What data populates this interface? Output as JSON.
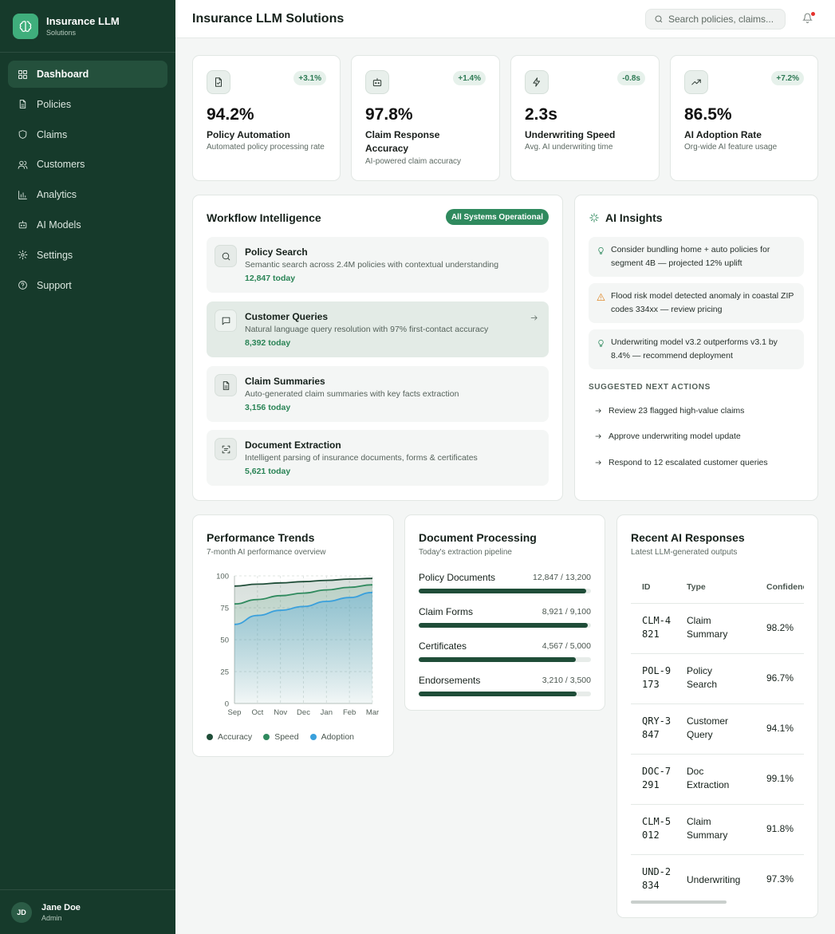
{
  "brand": {
    "title": "Insurance LLM",
    "subtitle": "Solutions"
  },
  "nav": [
    {
      "label": "Dashboard",
      "icon": "grid-icon",
      "active": true
    },
    {
      "label": "Policies",
      "icon": "document-icon"
    },
    {
      "label": "Claims",
      "icon": "shield-icon"
    },
    {
      "label": "Customers",
      "icon": "users-icon"
    },
    {
      "label": "Analytics",
      "icon": "bar-chart-icon"
    },
    {
      "label": "AI Models",
      "icon": "robot-icon"
    },
    {
      "label": "Settings",
      "icon": "gear-icon"
    },
    {
      "label": "Support",
      "icon": "help-circle-icon"
    }
  ],
  "user": {
    "initials": "JD",
    "name": "Jane Doe",
    "role": "Admin"
  },
  "header": {
    "title": "Insurance LLM Solutions",
    "search_placeholder": "Search policies, claims..."
  },
  "kpis": [
    {
      "value": "94.2%",
      "label": "Policy Automation",
      "desc": "Automated policy processing rate",
      "change": "+3.1%",
      "icon": "file-check-icon"
    },
    {
      "value": "97.8%",
      "label": "Claim Response Accuracy",
      "desc": "AI-powered claim accuracy",
      "change": "+1.4%",
      "icon": "robot-icon"
    },
    {
      "value": "2.3s",
      "label": "Underwriting Speed",
      "desc": "Avg. AI underwriting time",
      "change": "-0.8s",
      "icon": "lightning-icon"
    },
    {
      "value": "86.5%",
      "label": "AI Adoption Rate",
      "desc": "Org-wide AI feature usage",
      "change": "+7.2%",
      "icon": "trend-up-icon"
    }
  ],
  "workflow": {
    "title": "Workflow Intelligence",
    "status": "All Systems Operational",
    "items": [
      {
        "title": "Policy Search",
        "desc": "Semantic search across 2.4M policies with contextual understanding",
        "count": "12,847 today",
        "icon": "search-icon"
      },
      {
        "title": "Customer Queries",
        "desc": "Natural language query resolution with 97% first-contact accuracy",
        "count": "8,392 today",
        "icon": "message-icon"
      },
      {
        "title": "Claim Summaries",
        "desc": "Auto-generated claim summaries with key facts extraction",
        "count": "3,156 today",
        "icon": "document-icon"
      },
      {
        "title": "Document Extraction",
        "desc": "Intelligent parsing of insurance documents, forms & certificates",
        "count": "5,621 today",
        "icon": "scan-icon"
      }
    ]
  },
  "insights": {
    "title": "AI Insights",
    "items": [
      {
        "text": "Consider bundling home + auto policies for segment 4B — projected 12% uplift",
        "icon": "lightbulb-icon",
        "color": "#2f8a5e"
      },
      {
        "text": "Flood risk model detected anomaly in coastal ZIP codes 334xx — review pricing",
        "icon": "warning-icon",
        "color": "#e08a2c"
      },
      {
        "text": "Underwriting model v3.2 outperforms v3.1 by 8.4% — recommend deployment",
        "icon": "lightbulb-icon",
        "color": "#2f8a5e"
      }
    ],
    "next_heading": "SUGGESTED NEXT ACTIONS",
    "next_actions": [
      "Review 23 flagged high-value claims",
      "Approve underwriting model update",
      "Respond to 12 escalated customer queries"
    ]
  },
  "trends": {
    "title": "Performance Trends",
    "subtitle": "7-month AI performance overview"
  },
  "chart_data": {
    "type": "area",
    "categories": [
      "Sep",
      "Oct",
      "Nov",
      "Dec",
      "Jan",
      "Feb",
      "Mar"
    ],
    "ylim": [
      0,
      100
    ],
    "yticks": [
      0,
      25,
      50,
      75,
      100
    ],
    "grid": true,
    "legend": "bottom",
    "series": [
      {
        "name": "Accuracy",
        "color": "#1f4d38",
        "values": [
          92,
          93.5,
          94.5,
          95.5,
          96.5,
          97.5,
          98
        ]
      },
      {
        "name": "Speed",
        "color": "#2f8a5e",
        "values": [
          78,
          81.5,
          84.5,
          86.5,
          89,
          91,
          93
        ]
      },
      {
        "name": "Adoption",
        "color": "#3aa0dc",
        "values": [
          62,
          69,
          73,
          76,
          80,
          83,
          87
        ]
      }
    ]
  },
  "docs": {
    "title": "Document Processing",
    "subtitle": "Today's extraction pipeline",
    "rows": [
      {
        "name": "Policy Documents",
        "value": "12,847 / 13,200",
        "done": 12847,
        "total": 13200
      },
      {
        "name": "Claim Forms",
        "value": "8,921 / 9,100",
        "done": 8921,
        "total": 9100
      },
      {
        "name": "Certificates",
        "value": "4,567 / 5,000",
        "done": 4567,
        "total": 5000
      },
      {
        "name": "Endorsements",
        "value": "3,210 / 3,500",
        "done": 3210,
        "total": 3500
      }
    ]
  },
  "recent": {
    "title": "Recent AI Responses",
    "subtitle": "Latest LLM-generated outputs",
    "columns": [
      "ID",
      "Type",
      "Confidence"
    ],
    "rows": [
      {
        "id": "CLM-4821",
        "type": "Claim Summary",
        "conf": "98.2%"
      },
      {
        "id": "POL-9173",
        "type": "Policy Search",
        "conf": "96.7%"
      },
      {
        "id": "QRY-3847",
        "type": "Customer Query",
        "conf": "94.1%"
      },
      {
        "id": "DOC-7291",
        "type": "Doc Extraction",
        "conf": "99.1%"
      },
      {
        "id": "CLM-5012",
        "type": "Claim Summary",
        "conf": "91.8%"
      },
      {
        "id": "UND-2834",
        "type": "Underwriting",
        "conf": "97.3%"
      }
    ]
  }
}
